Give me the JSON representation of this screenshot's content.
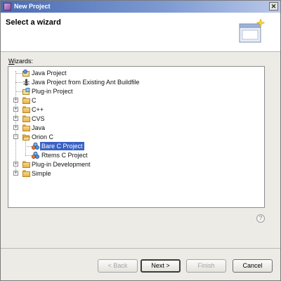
{
  "window": {
    "title": "New Project",
    "close_label": "✕"
  },
  "header": {
    "title": "Select a wizard"
  },
  "wizards_label": {
    "prefix": "W",
    "rest": "izards:"
  },
  "tree": {
    "items": [
      {
        "label": "Java Project",
        "icon": "java-project-icon",
        "level": 1,
        "expander": "",
        "selected": false
      },
      {
        "label": "Java Project from Existing Ant Buildfile",
        "icon": "ant-buildfile-icon",
        "level": 1,
        "expander": "",
        "selected": false
      },
      {
        "label": "Plug-in Project",
        "icon": "plugin-project-icon",
        "level": 1,
        "expander": "",
        "selected": false
      },
      {
        "label": "C",
        "icon": "folder-icon",
        "level": 1,
        "expander": "+",
        "selected": false
      },
      {
        "label": "C++",
        "icon": "folder-icon",
        "level": 1,
        "expander": "+",
        "selected": false
      },
      {
        "label": "CVS",
        "icon": "folder-icon",
        "level": 1,
        "expander": "+",
        "selected": false
      },
      {
        "label": "Java",
        "icon": "folder-icon",
        "level": 1,
        "expander": "+",
        "selected": false
      },
      {
        "label": "Orion C",
        "icon": "open-folder-icon",
        "level": 1,
        "expander": "−",
        "selected": false
      },
      {
        "label": "Bare C Project",
        "icon": "c-project-icon",
        "level": 2,
        "expander": "",
        "selected": true
      },
      {
        "label": "Rtems C Project",
        "icon": "c-project-icon",
        "level": 2,
        "expander": "",
        "selected": false
      },
      {
        "label": "Plug-in Development",
        "icon": "folder-icon",
        "level": 1,
        "expander": "+",
        "selected": false
      },
      {
        "label": "Simple",
        "icon": "folder-icon",
        "level": 1,
        "expander": "+",
        "selected": false
      }
    ]
  },
  "help": {
    "label": "?"
  },
  "buttons": {
    "back": "< Back",
    "next": "Next >",
    "finish": "Finish",
    "cancel": "Cancel"
  },
  "colors": {
    "selection": "#3a62c4",
    "titlebar": "#4a6cb4"
  }
}
